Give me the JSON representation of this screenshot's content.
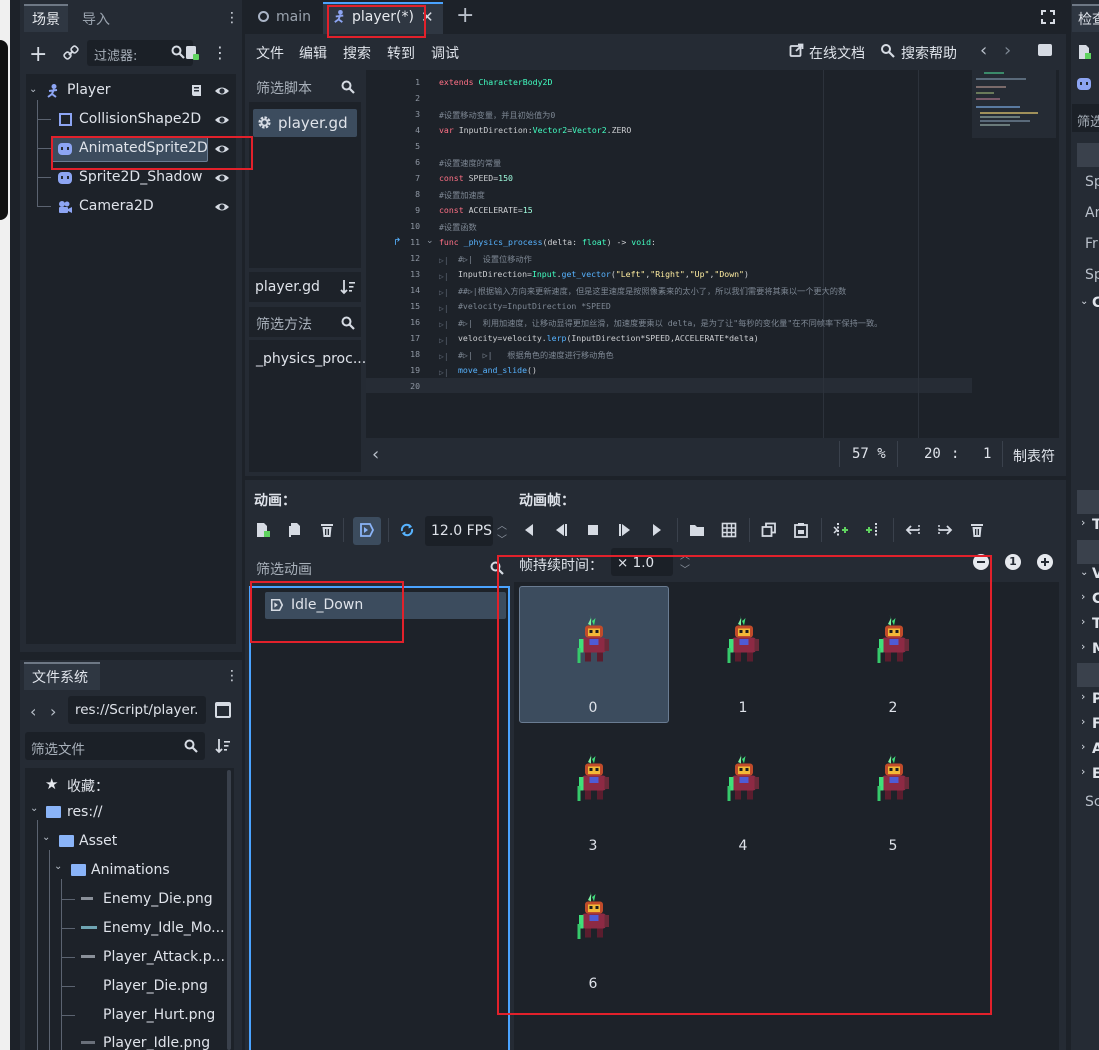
{
  "scene_dock": {
    "tabs": [
      "场景",
      "导入"
    ],
    "filter_placeholder": "过滤器:",
    "nodes": [
      {
        "name": "Player"
      },
      {
        "name": "CollisionShape2D"
      },
      {
        "name": "AnimatedSprite2D"
      },
      {
        "name": "Sprite2D_Shadow"
      },
      {
        "name": "Camera2D"
      }
    ]
  },
  "editor_tabs": [
    {
      "label": "main"
    },
    {
      "label": "player(*)"
    }
  ],
  "script_menu": [
    "文件",
    "编辑",
    "搜索",
    "转到",
    "调试"
  ],
  "script_links": {
    "online_docs": "在线文档",
    "search_help": "搜索帮助"
  },
  "script_list": {
    "filter_scripts": "筛选脚本",
    "current_script": "player.gd",
    "script_name": "player.gd",
    "filter_methods": "筛选方法",
    "methods": [
      "_physics_proc..."
    ]
  },
  "code": {
    "line_numbers": [
      "1",
      "2",
      "3",
      "4",
      "5",
      "6",
      "7",
      "8",
      "9",
      "10",
      "11",
      "12",
      "13",
      "14",
      "15",
      "16",
      "17",
      "18",
      "19",
      "20"
    ],
    "lines": {
      "l1a": "extends",
      "l1b": " CharacterBody2D",
      "l3": "#设置移动变量，并且初始值为0",
      "l4a": "var",
      "l4b": " InputDirection:",
      "l4c": "Vector2",
      "l4d": "=",
      "l4e": "Vector2",
      "l4f": ".ZERO",
      "l6": "#设置速度的常量",
      "l7a": "const",
      "l7b": " SPEED=",
      "l7c": "150",
      "l8": "#设置加速度",
      "l9a": "const",
      "l9b": " ACCELERATE=",
      "l9c": "15",
      "l10": "#设置函数",
      "l11a": "func",
      "l11b": " _physics_process",
      "l11c": "(delta: ",
      "l11d": "float",
      "l11e": ") -> ",
      "l11f": "void",
      "l12": "#▷|  设置位移动作",
      "l13a": "InputDirection=",
      "l13b": "Input",
      "l13c": ".",
      "l13d": "get_vector",
      "l13e": "(",
      "l13f": "\"Left\"",
      "l13g": ",",
      "l13h": "\"Right\"",
      "l13i": ",",
      "l13j": "\"Up\"",
      "l13k": ",",
      "l13l": "\"Down\"",
      "l13m": ")",
      "l14": "##▷|根据输入方向来更新速度，但是这里速度是按照像素来的太小了，所以我们需要将其乘以一个更大的数",
      "l15": "#velocity=InputDirection *SPEED",
      "l16": "#▷|  利用加速度，让移动显得更加丝滑，加速度要乘以 delta，是为了让\"每秒的变化量\"在不同帧率下保持一致。",
      "l17a": "velocity=velocity.",
      "l17b": "lerp",
      "l17c": "(InputDirection*SPEED,ACCELERATE*delta)",
      "l18": "#▷|  ▷|   根据角色的速度进行移动角色",
      "l19a": "move_and_slide",
      "l19b": "()"
    }
  },
  "status_bar": {
    "zoom": "57 %",
    "line": "20",
    "colon": ":",
    "col": "1",
    "indent": "制表符"
  },
  "sprite_frames": {
    "animations_title": "动画：",
    "frames_title": "动画帧：",
    "fps": "12.0 FPS",
    "filter_animations": "筛选动画",
    "animations": [
      "Idle_Down"
    ],
    "frame_duration_label": "帧持续时间：",
    "frame_duration_value": "× 1.0",
    "frames": [
      "0",
      "1",
      "2",
      "3",
      "4",
      "5",
      "6"
    ],
    "selected_frame": 0
  },
  "filesystem": {
    "title": "文件系统",
    "path": "res://Script/player.",
    "filter_placeholder": "筛选文件",
    "favorites": "收藏：",
    "root": "res://",
    "items": [
      {
        "label": "Asset"
      },
      {
        "label": "Animations"
      },
      {
        "label": "Enemy_Die.png"
      },
      {
        "label": "Enemy_Idle_Mo..."
      },
      {
        "label": "Player_Attack.p..."
      },
      {
        "label": "Player_Die.png"
      },
      {
        "label": "Player_Hurt.png"
      },
      {
        "label": "Player_Idle.png"
      }
    ]
  },
  "inspector": {
    "title": "检查",
    "filter_partial": "筛选",
    "props": [
      "Sp",
      "An",
      "Fr",
      "Sp",
      "C",
      "T",
      "V",
      "C",
      "T",
      "M",
      "P",
      "F",
      "A",
      "E",
      "Sc"
    ]
  },
  "colors": {
    "accent": "#4aa3ff",
    "selection": "#3c4c5e",
    "highlight_box": "#e2212b"
  }
}
